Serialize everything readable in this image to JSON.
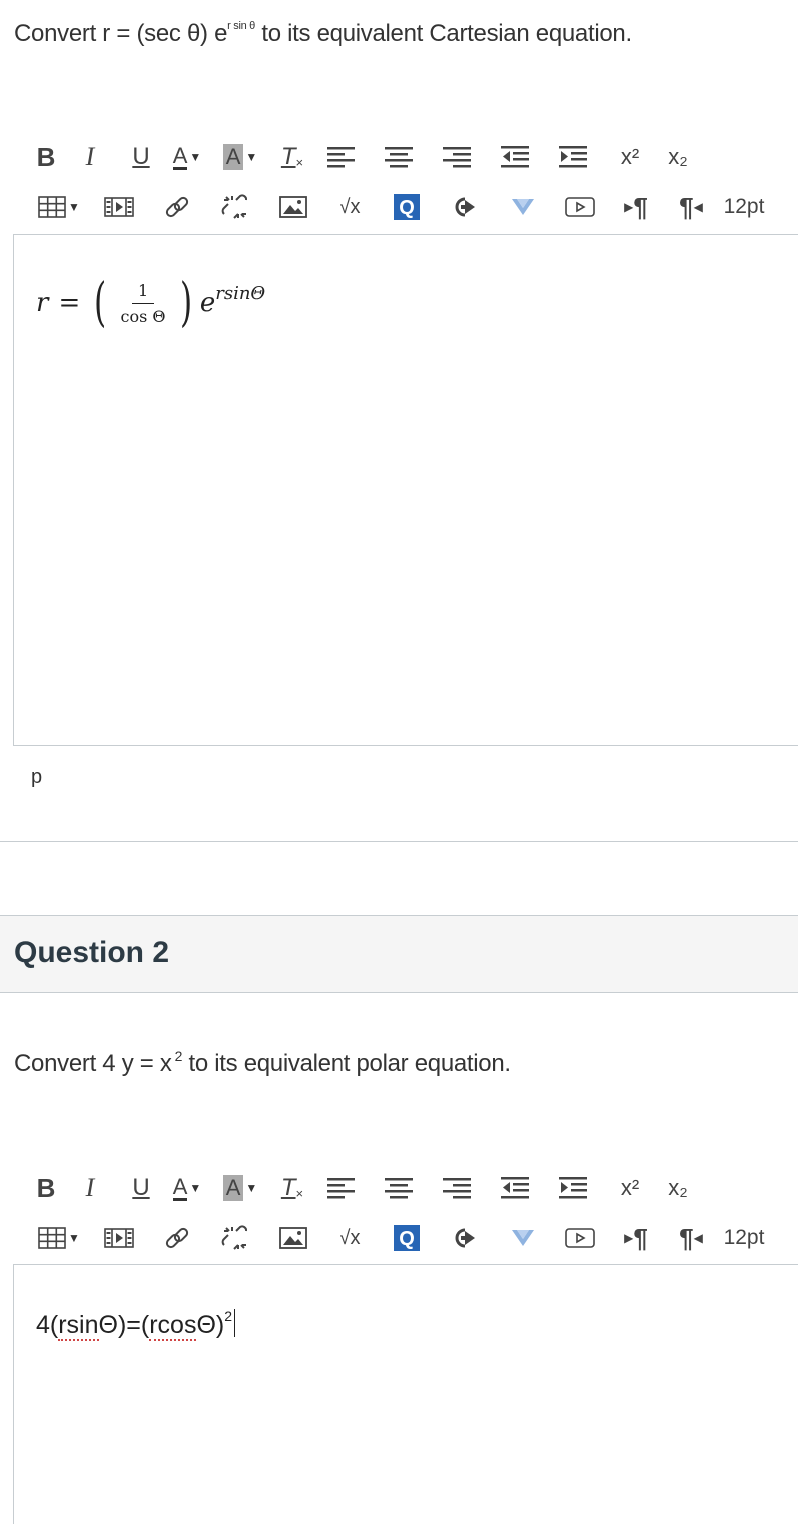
{
  "question1": {
    "prompt_prefix": "Convert  r =  (sec θ) e",
    "prompt_sup": "r sin θ",
    "prompt_suffix": "  to its equivalent Cartesian equation.",
    "answer": {
      "lhs": "r",
      "eq": "=",
      "frac_num": "1",
      "frac_den": "cos Θ",
      "base": "e",
      "exponent": "rsinΘ"
    },
    "status_path": "p"
  },
  "question2": {
    "header": "Question 2",
    "prompt_prefix": "Convert  4 y  =  x",
    "prompt_sup": "2",
    "prompt_suffix": "  to its equivalent polar equation.",
    "answer": {
      "part1": "4(",
      "word1": "rsin",
      "part2": "Θ)=(",
      "word2": "rcos",
      "part3": "Θ)",
      "power": "2"
    }
  },
  "toolbar": {
    "bold": "B",
    "italic": "I",
    "underline": "U",
    "font_color": "A",
    "bg_color": "A",
    "clear_format": "T",
    "superscript": "x²",
    "subscript": "x₂",
    "font_size": "12pt",
    "sqrt": "√x",
    "pilcrow_ltr": "¶",
    "pilcrow_rtl": "¶"
  },
  "colors": {
    "accent_blue": "#2765b5",
    "border": "#c7cdd1",
    "header_bg": "#f5f5f5"
  }
}
